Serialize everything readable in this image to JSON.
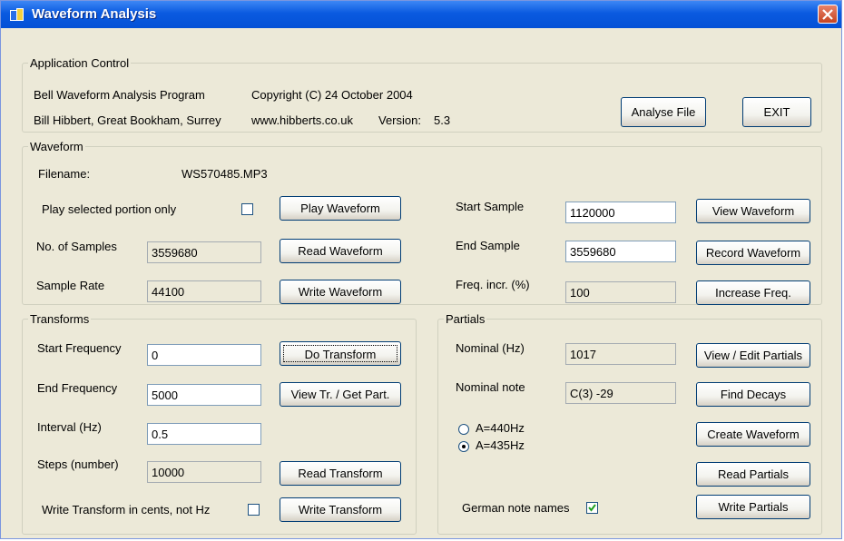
{
  "window": {
    "title": "Waveform Analysis"
  },
  "app_control": {
    "legend": "Application Control",
    "program": "Bell Waveform Analysis Program",
    "copyright": "Copyright (C) 24 October 2004",
    "author": "Bill Hibbert, Great Bookham, Surrey",
    "website": "www.hibberts.co.uk",
    "version_label": "Version:",
    "version": "5.3",
    "analyse_button": "Analyse File",
    "exit_button": "EXIT"
  },
  "waveform": {
    "legend": "Waveform",
    "filename_label": "Filename:",
    "filename": "WS570485.MP3",
    "play_selected_label": "Play selected portion only",
    "play_selected_checked": false,
    "play_button": "Play Waveform",
    "samples_label": "No. of Samples",
    "samples_value": "3559680",
    "read_button": "Read Waveform",
    "rate_label": "Sample Rate",
    "rate_value": "44100",
    "write_button": "Write Waveform",
    "start_label": "Start Sample",
    "start_value": "1120000",
    "view_button": "View Waveform",
    "end_label": "End Sample",
    "end_value": "3559680",
    "record_button": "Record Waveform",
    "freq_incr_label": "Freq. incr. (%)",
    "freq_incr_value": "100",
    "increase_button": "Increase Freq."
  },
  "transforms": {
    "legend": "Transforms",
    "start_freq_label": "Start Frequency",
    "start_freq_value": "0",
    "do_button": "Do Transform",
    "end_freq_label": "End Frequency",
    "end_freq_value": "5000",
    "view_button": "View Tr. / Get Part.",
    "interval_label": "Interval (Hz)",
    "interval_value": "0.5",
    "steps_label": "Steps (number)",
    "steps_value": "10000",
    "read_button": "Read Transform",
    "cents_label": "Write Transform in cents, not Hz",
    "cents_checked": false,
    "write_button": "Write Transform"
  },
  "partials": {
    "legend": "Partials",
    "nominal_label": "Nominal (Hz)",
    "nominal_value": "1017",
    "view_edit_button": "View / Edit Partials",
    "note_label": "Nominal note",
    "note_value": "C(3) -29",
    "find_decays_button": "Find Decays",
    "a440_label": "A=440Hz",
    "a435_label": "A=435Hz",
    "selected_pitch": "A=435Hz",
    "create_button": "Create Waveform",
    "read_button": "Read Partials",
    "german_label": "German note names",
    "german_checked": true,
    "write_button": "Write Partials"
  }
}
